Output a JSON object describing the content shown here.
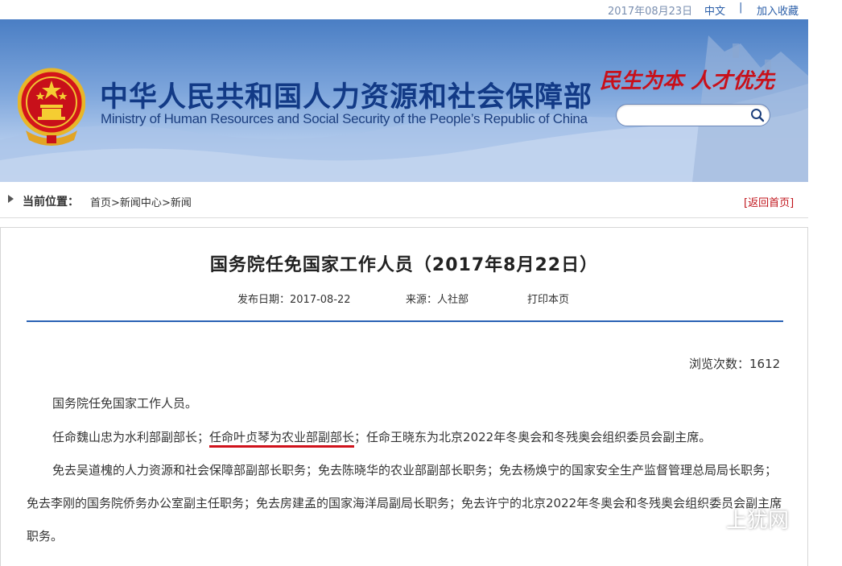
{
  "topbar": {
    "date": "2017年08月23日",
    "lang": "中文",
    "separator": "|",
    "favorite": "加入收藏"
  },
  "header": {
    "title_cn": "中华人民共和国人力资源和社会保障部",
    "title_en": "Ministry of Human Resources and Social Security of the People’s Republic of China",
    "slogan": "民生为本  人才优先",
    "search_placeholder": "",
    "icons": [
      "national-emblem",
      "search-icon"
    ],
    "colors": {
      "title": "#123a86",
      "slogan": "#c8101a",
      "banner_top": "#4a7ec4"
    }
  },
  "breadcrumb": {
    "label": "当前位置：",
    "home": "首页",
    "news_center": "新闻中心",
    "news": "新闻",
    "sep": ">",
    "back": "[返回首页]"
  },
  "article": {
    "title": "国务院任免国家工作人员（2017年8月22日）",
    "publish_date": "发布日期：2017-08-22",
    "source": "来源：人社部",
    "print": "打印本页",
    "views": "浏览次数：1612",
    "p1": "国务院任免国家工作人员。",
    "p2_a": "任命魏山忠为水利部副部长；",
    "p2_b": "任命叶贞琴为农业部副部长",
    "p2_c": "；任命王晓东为北京2022年冬奥会和冬残奥会组织委员会副主席。",
    "p3": "免去吴道槐的人力资源和社会保障部副部长职务；免去陈晓华的农业部副部长职务；免去杨焕宁的国家安全生产监督管理总局局长职务；免去李刚的国务院侨务办公室副主任职务；免去房建孟的国家海洋局副局长职务；免去许宁的北京2022年冬奥会和冬残奥会组织委员会副主席职务。"
  },
  "watermark": {
    "text": "上犹网",
    "icon": "wechat-icon"
  }
}
